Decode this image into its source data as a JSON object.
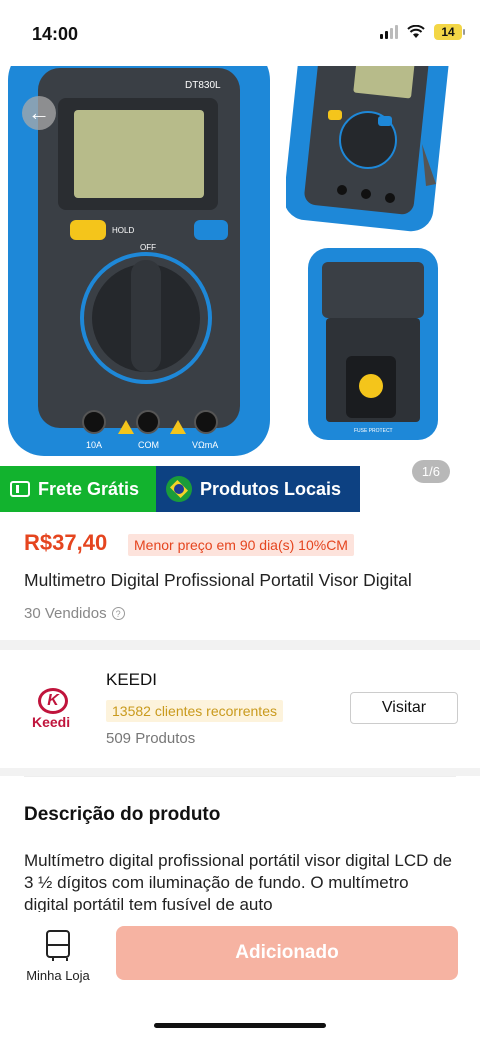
{
  "status_bar": {
    "time": "14:00",
    "battery": "14"
  },
  "gallery": {
    "page_indicator": "1/6",
    "back_icon": "arrow-left-icon"
  },
  "product_images": {
    "main_model": "DT830L",
    "hold_label": "HOLD",
    "off_label": "OFF",
    "com_label": "COM",
    "port_10a": "10A",
    "port_vma": "VΩmA",
    "side_badge": "FUSE PROTECT"
  },
  "badges": {
    "frete": "Frete Grátis",
    "locais": "Produtos Locais"
  },
  "price_card": {
    "price": "R$37,40",
    "tag": "Menor preço em 90 dia(s)   10%CM",
    "title": "Multimetro Digital Profissional Portatil Visor Digital",
    "sold": "30 Vendidos"
  },
  "store": {
    "logo_text": "Keedi",
    "name": "KEEDI",
    "tag": "13582 clientes recorrentes",
    "products": "509 Produtos",
    "visit": "Visitar"
  },
  "description": {
    "title": "Descrição do produto",
    "text": "Multímetro digital profissional portátil visor digital LCD de 3 ½ dígitos com iluminação de fundo. O multímetro digital portátil tem fusível de auto"
  },
  "bottom_bar": {
    "shop_label": "Minha Loja",
    "add_button": "Adicionado"
  },
  "colors": {
    "accent": "#e5451f",
    "frete_green": "#12b32e",
    "locais_blue": "#0d4182",
    "button_disabled": "#f6b3a2"
  }
}
